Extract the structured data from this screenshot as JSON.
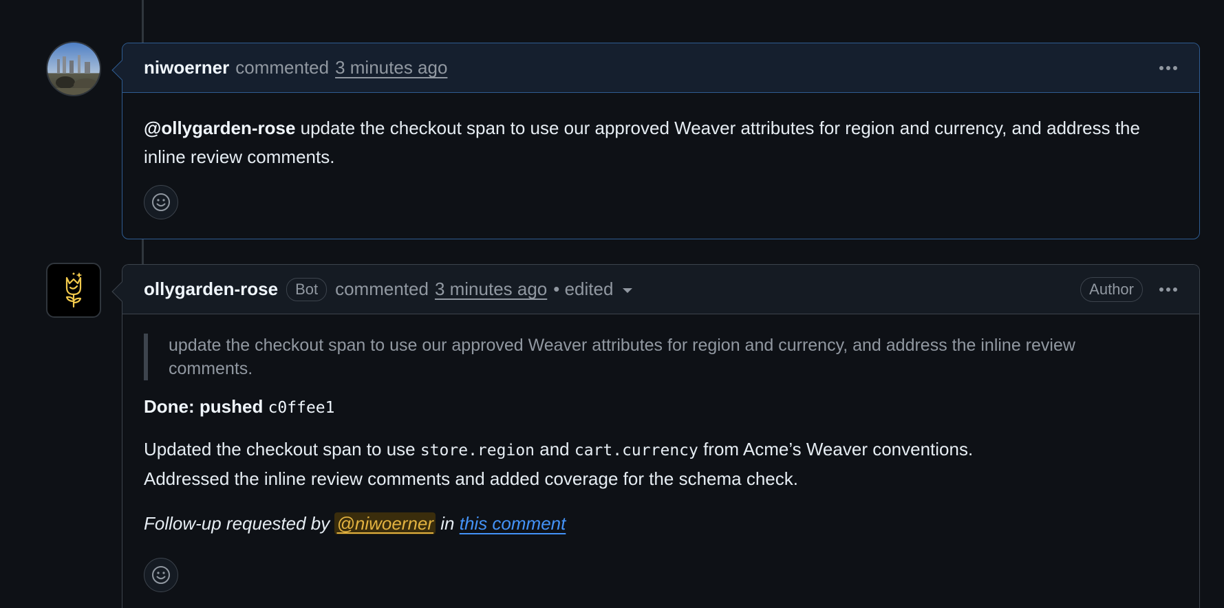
{
  "comment1": {
    "author": "niwoerner",
    "action": "commented",
    "time": "3 minutes ago",
    "mention": "@ollygarden-rose",
    "body": " update the checkout span to use our approved Weaver attributes for region and currency, and address the inline review comments."
  },
  "comment2": {
    "author": "ollygarden-rose",
    "bot_badge": "Bot",
    "action": "commented",
    "time": "3 minutes ago",
    "edited": "• edited",
    "author_badge": "Author",
    "quote": "update the checkout span to use our approved Weaver attributes for region and currency, and address the inline review comments.",
    "done_label": "Done: pushed ",
    "commit": "c0ffee1",
    "line1_a": "Updated the checkout span to use ",
    "code1": "store.region",
    "line1_b": " and ",
    "code2": "cart.currency",
    "line1_c": " from Acme’s Weaver conventions.",
    "line2": "Addressed the inline review comments and added coverage for the schema check.",
    "followup_a": "Follow-up requested by ",
    "followup_mention": "@niwoerner",
    "followup_b": " in ",
    "followup_link": "this comment"
  },
  "colors": {
    "accent_border": "#2f5d93",
    "link": "#4493f8",
    "mention_highlight": "#e3b341"
  },
  "icons": [
    "kebab-menu-icon",
    "smiley-icon",
    "rose-logo-icon",
    "chevron-down-icon"
  ]
}
